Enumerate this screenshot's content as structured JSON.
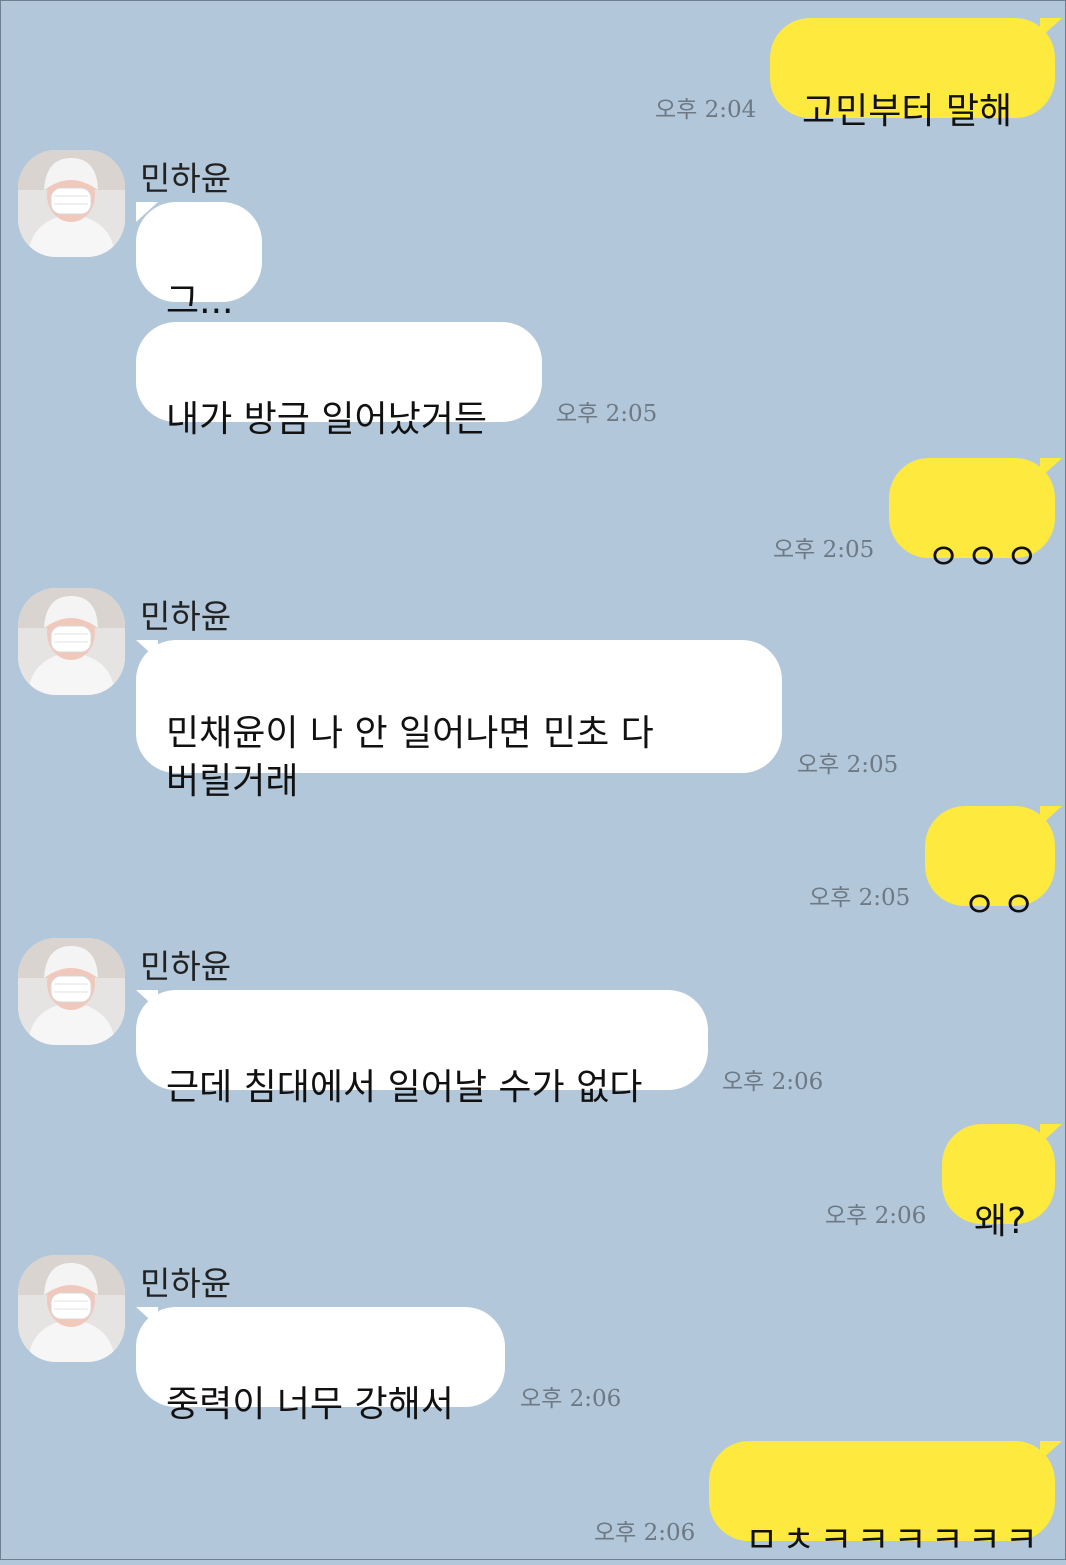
{
  "chat": {
    "sender_name": "민하윤",
    "colors": {
      "background": "#b2c7da",
      "my_bubble": "#fee93f",
      "their_bubble": "#ffffff",
      "timestamp": "#6d7984"
    },
    "messages": [
      {
        "from": "me",
        "text": "고민부터 말해",
        "time": "오후 2:04"
      },
      {
        "from": "them",
        "text": "그...",
        "time": ""
      },
      {
        "from": "them",
        "text": "내가 방금 일어났거든",
        "time": "오후 2:05"
      },
      {
        "from": "me",
        "text": "ㅇㅇㅇ",
        "time": "오후 2:05"
      },
      {
        "from": "them",
        "text": "민채윤이 나 안 일어나면 민초 다\n버릴거래",
        "time": "오후 2:05"
      },
      {
        "from": "me",
        "text": "ㅇㅇ",
        "time": "오후 2:05"
      },
      {
        "from": "them",
        "text": "근데 침대에서 일어날 수가 없다",
        "time": "오후 2:06"
      },
      {
        "from": "me",
        "text": "왜?",
        "time": "오후 2:06"
      },
      {
        "from": "them",
        "text": "중력이 너무 강해서",
        "time": "오후 2:06"
      },
      {
        "from": "me",
        "text": "ㅁㅊㅋㅋㅋㅋㅋㅋ",
        "time": "오후 2:06"
      }
    ]
  }
}
